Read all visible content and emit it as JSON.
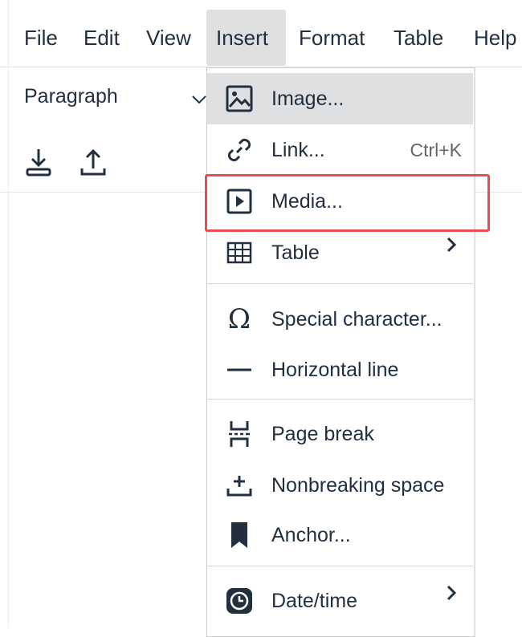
{
  "menubar": {
    "items": [
      {
        "label": "File"
      },
      {
        "label": "Edit"
      },
      {
        "label": "View"
      },
      {
        "label": "Insert"
      },
      {
        "label": "Format"
      },
      {
        "label": "Table"
      },
      {
        "label": "Help"
      }
    ],
    "active": "Insert"
  },
  "toolbar": {
    "block_format": "Paragraph",
    "icons": [
      "download-icon",
      "upload-icon"
    ]
  },
  "insert_menu": {
    "items": [
      {
        "label": "Image...",
        "icon": "image-icon"
      },
      {
        "label": "Link...",
        "icon": "link-icon",
        "shortcut": "Ctrl+K"
      },
      {
        "label": "Media...",
        "icon": "media-icon"
      },
      {
        "label": "Table",
        "icon": "table-icon",
        "submenu": true
      },
      {
        "label": "Special character...",
        "icon": "omega-icon"
      },
      {
        "label": "Horizontal line",
        "icon": "horizontal-line-icon"
      },
      {
        "label": "Page break",
        "icon": "page-break-icon"
      },
      {
        "label": "Nonbreaking space",
        "icon": "nonbreaking-space-icon"
      },
      {
        "label": "Anchor...",
        "icon": "bookmark-icon"
      },
      {
        "label": "Date/time",
        "icon": "clock-icon",
        "submenu": true
      }
    ],
    "hovered": "Image...",
    "highlighted": "Media..."
  },
  "colors": {
    "text": "#222f3e",
    "hover_bg": "#dee0e2",
    "highlight_border": "#e84b50"
  }
}
